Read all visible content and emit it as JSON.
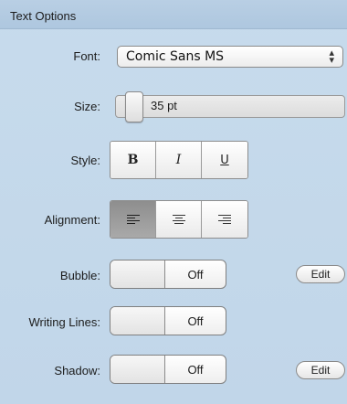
{
  "header": {
    "title": "Text Options"
  },
  "font": {
    "label": "Font:",
    "value": "Comic Sans MS",
    "arrows_icon": "up-down-arrows-icon"
  },
  "size": {
    "label": "Size:",
    "value_text": "35 pt"
  },
  "style": {
    "label": "Style:",
    "buttons": [
      {
        "label": "B",
        "name": "bold"
      },
      {
        "label": "I",
        "name": "italic"
      },
      {
        "label": "U",
        "name": "underline"
      }
    ]
  },
  "alignment": {
    "label": "Alignment:",
    "buttons": [
      {
        "name": "align-left-icon",
        "selected": true
      },
      {
        "name": "align-center-icon",
        "selected": false
      },
      {
        "name": "align-right-icon",
        "selected": false
      }
    ]
  },
  "bubble": {
    "label": "Bubble:",
    "state": "Off",
    "edit_label": "Edit"
  },
  "writing_lines": {
    "label": "Writing Lines:",
    "state": "Off"
  },
  "shadow": {
    "label": "Shadow:",
    "state": "Off",
    "edit_label": "Edit"
  },
  "colors": {
    "panel": "#c4d8ea",
    "header": "#b2cae1",
    "selected_segment": "#9a9a9a"
  }
}
